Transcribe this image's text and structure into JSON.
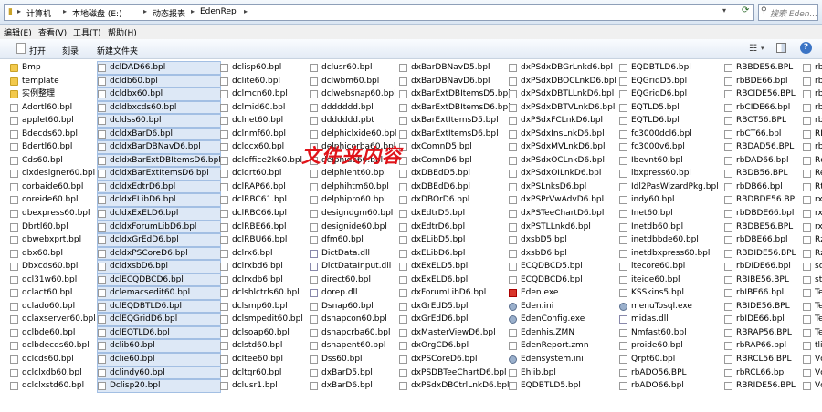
{
  "address": {
    "crumbs": [
      "计算机",
      "本地磁盘 (E:)",
      "动态报表",
      "EdenRep"
    ],
    "search_placeholder": "搜索 Eden..."
  },
  "menu": [
    "编辑(E)",
    "查看(V)",
    "工具(T)",
    "帮助(H)"
  ],
  "toolbar": {
    "open": "打开",
    "burn": "刻录",
    "new_folder": "新建文件夹"
  },
  "watermark": "文件夹内容",
  "columns": [
    [
      {
        "name": "Bmp",
        "type": "folder"
      },
      {
        "name": "template",
        "type": "folder"
      },
      {
        "name": "实例整理",
        "type": "folder"
      },
      {
        "name": "Adortl60.bpl"
      },
      {
        "name": "applet60.bpl"
      },
      {
        "name": "Bdecds60.bpl"
      },
      {
        "name": "Bdertl60.bpl"
      },
      {
        "name": "Cds60.bpl"
      },
      {
        "name": "clxdesigner60.bpl"
      },
      {
        "name": "corbaide60.bpl"
      },
      {
        "name": "coreide60.bpl"
      },
      {
        "name": "dbexpress60.bpl"
      },
      {
        "name": "Dbrtl60.bpl"
      },
      {
        "name": "dbwebxprt.bpl"
      },
      {
        "name": "dbx60.bpl"
      },
      {
        "name": "Dbxcds60.bpl"
      },
      {
        "name": "dcl31w60.bpl"
      },
      {
        "name": "dclact60.bpl"
      },
      {
        "name": "dclado60.bpl"
      },
      {
        "name": "dclaxserver60.bpl"
      },
      {
        "name": "dclbde60.bpl"
      },
      {
        "name": "dclbdecds60.bpl"
      },
      {
        "name": "dclcds60.bpl"
      },
      {
        "name": "dclclxdb60.bpl"
      },
      {
        "name": "dclclxstd60.bpl"
      }
    ],
    [
      {
        "name": "dclDAD66.bpl",
        "sel": true
      },
      {
        "name": "dcldb60.bpl",
        "sel": true
      },
      {
        "name": "dcldbx60.bpl",
        "sel": true
      },
      {
        "name": "dcldbxcds60.bpl",
        "sel": true
      },
      {
        "name": "dcldss60.bpl",
        "sel": true
      },
      {
        "name": "dcldxBarD6.bpl",
        "sel": true
      },
      {
        "name": "dcldxBarDBNavD6.bpl",
        "sel": true
      },
      {
        "name": "dcldxBarExtDBItemsD6.bpl",
        "sel": true
      },
      {
        "name": "dcldxBarExtItemsD6.bpl",
        "sel": true
      },
      {
        "name": "dcldxEdtrD6.bpl",
        "sel": true
      },
      {
        "name": "dcldxELibD6.bpl",
        "sel": true
      },
      {
        "name": "dcldxExELD6.bpl",
        "sel": true
      },
      {
        "name": "dcldxForumLibD6.bpl",
        "sel": true
      },
      {
        "name": "dcldxGrEdD6.bpl",
        "sel": true
      },
      {
        "name": "dcldxPSCoreD6.bpl",
        "sel": true
      },
      {
        "name": "dcldxsbD6.bpl",
        "sel": true
      },
      {
        "name": "dclECQDBCD6.bpl",
        "sel": true
      },
      {
        "name": "dclemacsedit60.bpl",
        "sel": true
      },
      {
        "name": "dclEQDBTLD6.bpl",
        "sel": true
      },
      {
        "name": "dclEQGridD6.bpl",
        "sel": true
      },
      {
        "name": "dclEQTLD6.bpl",
        "sel": true
      },
      {
        "name": "dclib60.bpl",
        "sel": true
      },
      {
        "name": "dclie60.bpl",
        "sel": true
      },
      {
        "name": "dclindy60.bpl",
        "sel": true
      },
      {
        "name": "Dclisp20.bpl",
        "sel": true
      }
    ],
    [
      {
        "name": "dclisp60.bpl"
      },
      {
        "name": "dclite60.bpl"
      },
      {
        "name": "dclmcn60.bpl"
      },
      {
        "name": "dclmid60.bpl"
      },
      {
        "name": "dclnet60.bpl"
      },
      {
        "name": "dclnmf60.bpl"
      },
      {
        "name": "dclocx60.bpl"
      },
      {
        "name": "dcloffice2k60.bpl"
      },
      {
        "name": "dclqrt60.bpl"
      },
      {
        "name": "dclRAP66.bpl"
      },
      {
        "name": "dclRBC61.bpl"
      },
      {
        "name": "dclRBC66.bpl"
      },
      {
        "name": "dclRBE66.bpl"
      },
      {
        "name": "dclRBU66.bpl"
      },
      {
        "name": "dclrx6.bpl"
      },
      {
        "name": "dclrxbd6.bpl"
      },
      {
        "name": "dclrxdb6.bpl"
      },
      {
        "name": "dclshlctrls60.bpl"
      },
      {
        "name": "dclsmp60.bpl"
      },
      {
        "name": "dclsmpedit60.bpl"
      },
      {
        "name": "dclsoap60.bpl"
      },
      {
        "name": "dclstd60.bpl"
      },
      {
        "name": "dcltee60.bpl"
      },
      {
        "name": "dcltqr60.bpl"
      },
      {
        "name": "dclusr1.bpl"
      }
    ],
    [
      {
        "name": "dclusr60.bpl"
      },
      {
        "name": "dclwbm60.bpl"
      },
      {
        "name": "dclwebsnap60.bpl"
      },
      {
        "name": "ddddddd.bpl"
      },
      {
        "name": "ddddddd.pbt"
      },
      {
        "name": "delphiclxide60.bpl"
      },
      {
        "name": "delphicorba60.bpl"
      },
      {
        "name": "delphide60.bpl"
      },
      {
        "name": "delphient60.bpl"
      },
      {
        "name": "delphihtm60.bpl"
      },
      {
        "name": "delphipro60.bpl"
      },
      {
        "name": "designdgm60.bpl"
      },
      {
        "name": "designide60.bpl"
      },
      {
        "name": "dfm60.bpl"
      },
      {
        "name": "DictData.dll",
        "type": "dll"
      },
      {
        "name": "DictDataInput.dll",
        "type": "dll"
      },
      {
        "name": "direct60.bpl"
      },
      {
        "name": "dorep.dll",
        "type": "dll"
      },
      {
        "name": "Dsnap60.bpl"
      },
      {
        "name": "dsnapcon60.bpl"
      },
      {
        "name": "dsnapcrba60.bpl"
      },
      {
        "name": "dsnapent60.bpl"
      },
      {
        "name": "Dss60.bpl"
      },
      {
        "name": "dxBarD5.bpl"
      },
      {
        "name": "dxBarD6.bpl"
      }
    ],
    [
      {
        "name": "dxBarDBNavD5.bpl"
      },
      {
        "name": "dxBarDBNavD6.bpl"
      },
      {
        "name": "dxBarExtDBItemsD5.bpl"
      },
      {
        "name": "dxBarExtDBItemsD6.bpl"
      },
      {
        "name": "dxBarExtItemsD5.bpl"
      },
      {
        "name": "dxBarExtItemsD6.bpl"
      },
      {
        "name": "dxComnD5.bpl"
      },
      {
        "name": "dxComnD6.bpl"
      },
      {
        "name": "dxDBEdD5.bpl"
      },
      {
        "name": "dxDBEdD6.bpl"
      },
      {
        "name": "dxDBOrD6.bpl"
      },
      {
        "name": "dxEdtrD5.bpl"
      },
      {
        "name": "dxEdtrD6.bpl"
      },
      {
        "name": "dxELibD5.bpl"
      },
      {
        "name": "dxELibD6.bpl"
      },
      {
        "name": "dxExELD5.bpl"
      },
      {
        "name": "dxExELD6.bpl"
      },
      {
        "name": "dxForumLibD6.bpl"
      },
      {
        "name": "dxGrEdD5.bpl"
      },
      {
        "name": "dxGrEdD6.bpl"
      },
      {
        "name": "dxMasterViewD6.bpl"
      },
      {
        "name": "dxOrgCD6.bpl"
      },
      {
        "name": "dxPSCoreD6.bpl"
      },
      {
        "name": "dxPSDBTeeChartD6.bpl"
      },
      {
        "name": "dxPSdxDBCtrlLnkD6.bpl"
      }
    ],
    [
      {
        "name": "dxPSdxDBGrLnkd6.bpl"
      },
      {
        "name": "dxPSdxDBOCLnkD6.bpl"
      },
      {
        "name": "dxPSdxDBTLLnkD6.bpl"
      },
      {
        "name": "dxPSdxDBTVLnkD6.bpl"
      },
      {
        "name": "dxPSdxFCLnkD6.bpl"
      },
      {
        "name": "dxPSdxInsLnkD6.bpl"
      },
      {
        "name": "dxPSdxMVLnkD6.bpl"
      },
      {
        "name": "dxPSdxOCLnkD6.bpl"
      },
      {
        "name": "dxPSdxOILnkD6.bpl"
      },
      {
        "name": "dxPSLnksD6.bpl"
      },
      {
        "name": "dxPSPrVwAdvD6.bpl"
      },
      {
        "name": "dxPSTeeChartD6.bpl"
      },
      {
        "name": "dxPSTLLnkd6.bpl"
      },
      {
        "name": "dxsbD5.bpl"
      },
      {
        "name": "dxsbD6.bpl"
      },
      {
        "name": "ECQDBCD5.bpl"
      },
      {
        "name": "ECQDBCD6.bpl"
      },
      {
        "name": "Eden.exe",
        "type": "exe"
      },
      {
        "name": "Eden.ini",
        "type": "gear"
      },
      {
        "name": "EdenConfig.exe",
        "type": "gear"
      },
      {
        "name": "Edenhis.ZMN"
      },
      {
        "name": "EdenReport.zmn"
      },
      {
        "name": "Edensystem.ini",
        "type": "gear"
      },
      {
        "name": "Ehlib.bpl"
      },
      {
        "name": "EQDBTLD5.bpl"
      }
    ],
    [
      {
        "name": "EQDBTLD6.bpl"
      },
      {
        "name": "EQGridD5.bpl"
      },
      {
        "name": "EQGridD6.bpl"
      },
      {
        "name": "EQTLD5.bpl"
      },
      {
        "name": "EQTLD6.bpl"
      },
      {
        "name": "fc3000dcl6.bpl"
      },
      {
        "name": "fc3000v6.bpl"
      },
      {
        "name": "Ibevnt60.bpl"
      },
      {
        "name": "ibxpress60.bpl"
      },
      {
        "name": "Idl2PasWizardPkg.bpl"
      },
      {
        "name": "indy60.bpl"
      },
      {
        "name": "Inet60.bpl"
      },
      {
        "name": "Inetdb60.bpl"
      },
      {
        "name": "inetdbbde60.bpl"
      },
      {
        "name": "inetdbxpress60.bpl"
      },
      {
        "name": "itecore60.bpl"
      },
      {
        "name": "iteide60.bpl"
      },
      {
        "name": "KSSkins5.bpl"
      },
      {
        "name": "menuTosql.exe",
        "type": "gear"
      },
      {
        "name": "midas.dll",
        "type": "dll"
      },
      {
        "name": "Nmfast60.bpl"
      },
      {
        "name": "proide60.bpl"
      },
      {
        "name": "Qrpt60.bpl"
      },
      {
        "name": "rbADO56.BPL"
      },
      {
        "name": "rbADO66.bpl"
      }
    ],
    [
      {
        "name": "RBBDE56.BPL"
      },
      {
        "name": "rbBDE66.bpl"
      },
      {
        "name": "RBCIDE56.BPL"
      },
      {
        "name": "rbCIDE66.bpl"
      },
      {
        "name": "RBCT56.BPL"
      },
      {
        "name": "rbCT66.bpl"
      },
      {
        "name": "RBDAD56.BPL"
      },
      {
        "name": "rbDAD66.bpl"
      },
      {
        "name": "RBDB56.BPL"
      },
      {
        "name": "rbDB66.bpl"
      },
      {
        "name": "RBDBDE56.BPL"
      },
      {
        "name": "rbDBDE66.bpl"
      },
      {
        "name": "RBDBE56.BPL"
      },
      {
        "name": "rbDBE66.bpl"
      },
      {
        "name": "RBDIDE56.BPL"
      },
      {
        "name": "rbDIDE66.bpl"
      },
      {
        "name": "RBIBE56.BPL"
      },
      {
        "name": "rbIBE66.bpl"
      },
      {
        "name": "RBIDE56.BPL"
      },
      {
        "name": "rbIDE66.bpl"
      },
      {
        "name": "RBRAP56.BPL"
      },
      {
        "name": "rbRAP66.bpl"
      },
      {
        "name": "RBRCL56.BPL"
      },
      {
        "name": "rbRCL66.bpl"
      },
      {
        "name": "RBRIDE56.BPL"
      }
    ],
    [
      {
        "name": "rb"
      },
      {
        "name": "rb"
      },
      {
        "name": "rb"
      },
      {
        "name": "rb"
      },
      {
        "name": "rb"
      },
      {
        "name": "RB"
      },
      {
        "name": "rb"
      },
      {
        "name": "Rc"
      },
      {
        "name": "Re"
      },
      {
        "name": "Rt"
      },
      {
        "name": "rx"
      },
      {
        "name": "rx"
      },
      {
        "name": "rx"
      },
      {
        "name": "Rz"
      },
      {
        "name": "Rz"
      },
      {
        "name": "sc"
      },
      {
        "name": "sto"
      },
      {
        "name": "Te"
      },
      {
        "name": "Te"
      },
      {
        "name": "Te"
      },
      {
        "name": "Te"
      },
      {
        "name": "tlib"
      },
      {
        "name": "Vc"
      },
      {
        "name": "Vc"
      },
      {
        "name": "Vc"
      }
    ]
  ]
}
